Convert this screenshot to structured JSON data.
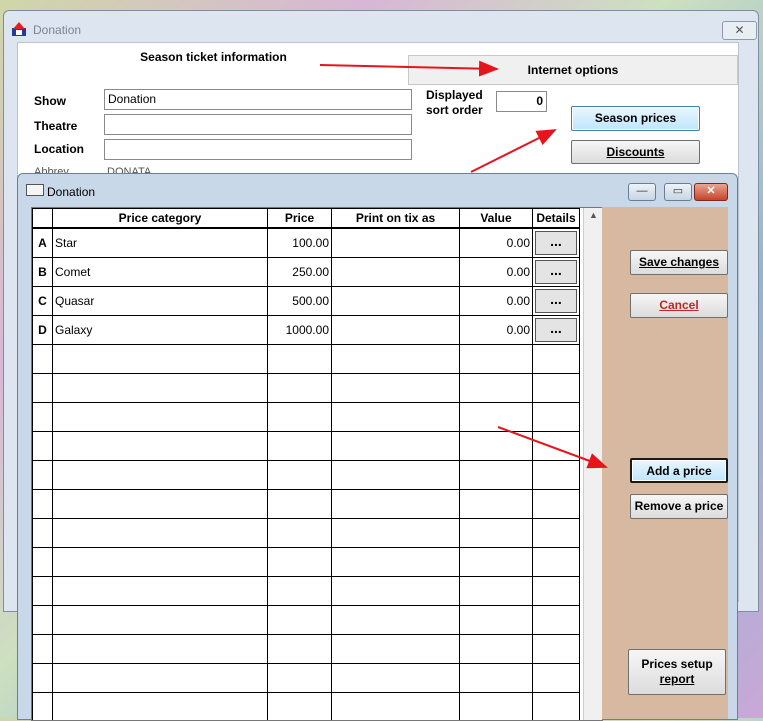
{
  "back_window": {
    "title": "Donation",
    "close_symbol": "✕",
    "tabs": [
      {
        "label": "Season ticket information",
        "active": true
      },
      {
        "label": "Internet options",
        "active": false
      }
    ],
    "fields": {
      "show_label": "Show",
      "show_value": "Donation",
      "theatre_label": "Theatre",
      "theatre_value": "",
      "location_label": "Location",
      "location_value": "",
      "abbrev_label": "Abbrev",
      "abbrev_value": "DONATA",
      "sort_label_line1": "Displayed",
      "sort_label_line2": "sort order",
      "sort_value": "0"
    },
    "buttons": {
      "season_prices": "Season prices",
      "discounts": "Discounts"
    }
  },
  "front_window": {
    "title": "Donation",
    "controls": {
      "minimize": "—",
      "maximize": "▭",
      "close": "✕"
    },
    "columns": [
      "",
      "Price category",
      "Price",
      "Print on tix as",
      "Value",
      "Details"
    ],
    "rows": [
      {
        "key": "A",
        "category": "Star",
        "price": "100.00",
        "print_as": "",
        "value": "0.00",
        "details": "..."
      },
      {
        "key": "B",
        "category": "Comet",
        "price": "250.00",
        "print_as": "",
        "value": "0.00",
        "details": "..."
      },
      {
        "key": "C",
        "category": "Quasar",
        "price": "500.00",
        "print_as": "",
        "value": "0.00",
        "details": "..."
      },
      {
        "key": "D",
        "category": "Galaxy",
        "price": "1000.00",
        "print_as": "",
        "value": "0.00",
        "details": "..."
      }
    ],
    "empty_rows": 13,
    "scroll_up_symbol": "▲",
    "side_buttons": {
      "save_changes": "Save changes",
      "cancel": "Cancel",
      "add_price": "Add a price",
      "remove_price": "Remove a price",
      "prices_report_line1": "Prices setup",
      "prices_report_line2": "report"
    }
  },
  "colors": {
    "side_panel": "#d6b9a0",
    "cancel_text": "#c0272d",
    "annotation_arrow": "#e8141b"
  }
}
